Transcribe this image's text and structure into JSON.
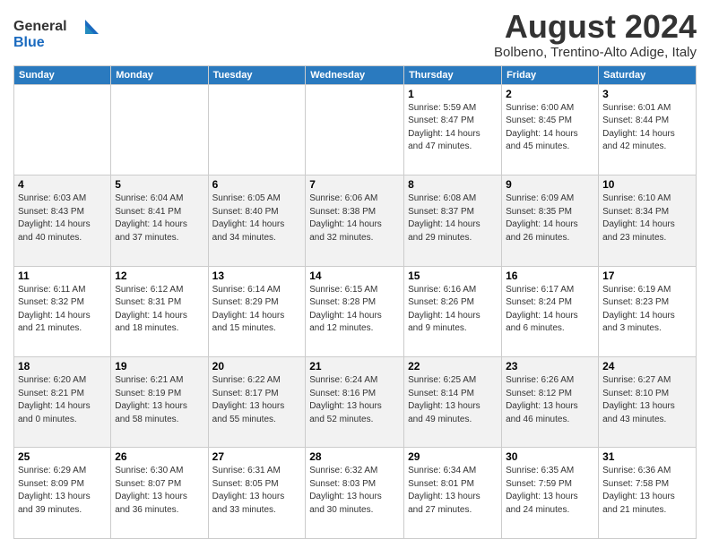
{
  "header": {
    "logo_line1": "General",
    "logo_line2": "Blue",
    "title": "August 2024",
    "subtitle": "Bolbeno, Trentino-Alto Adige, Italy"
  },
  "calendar": {
    "headers": [
      "Sunday",
      "Monday",
      "Tuesday",
      "Wednesday",
      "Thursday",
      "Friday",
      "Saturday"
    ],
    "weeks": [
      [
        {
          "day": "",
          "info": ""
        },
        {
          "day": "",
          "info": ""
        },
        {
          "day": "",
          "info": ""
        },
        {
          "day": "",
          "info": ""
        },
        {
          "day": "1",
          "info": "Sunrise: 5:59 AM\nSunset: 8:47 PM\nDaylight: 14 hours\nand 47 minutes."
        },
        {
          "day": "2",
          "info": "Sunrise: 6:00 AM\nSunset: 8:45 PM\nDaylight: 14 hours\nand 45 minutes."
        },
        {
          "day": "3",
          "info": "Sunrise: 6:01 AM\nSunset: 8:44 PM\nDaylight: 14 hours\nand 42 minutes."
        }
      ],
      [
        {
          "day": "4",
          "info": "Sunrise: 6:03 AM\nSunset: 8:43 PM\nDaylight: 14 hours\nand 40 minutes."
        },
        {
          "day": "5",
          "info": "Sunrise: 6:04 AM\nSunset: 8:41 PM\nDaylight: 14 hours\nand 37 minutes."
        },
        {
          "day": "6",
          "info": "Sunrise: 6:05 AM\nSunset: 8:40 PM\nDaylight: 14 hours\nand 34 minutes."
        },
        {
          "day": "7",
          "info": "Sunrise: 6:06 AM\nSunset: 8:38 PM\nDaylight: 14 hours\nand 32 minutes."
        },
        {
          "day": "8",
          "info": "Sunrise: 6:08 AM\nSunset: 8:37 PM\nDaylight: 14 hours\nand 29 minutes."
        },
        {
          "day": "9",
          "info": "Sunrise: 6:09 AM\nSunset: 8:35 PM\nDaylight: 14 hours\nand 26 minutes."
        },
        {
          "day": "10",
          "info": "Sunrise: 6:10 AM\nSunset: 8:34 PM\nDaylight: 14 hours\nand 23 minutes."
        }
      ],
      [
        {
          "day": "11",
          "info": "Sunrise: 6:11 AM\nSunset: 8:32 PM\nDaylight: 14 hours\nand 21 minutes."
        },
        {
          "day": "12",
          "info": "Sunrise: 6:12 AM\nSunset: 8:31 PM\nDaylight: 14 hours\nand 18 minutes."
        },
        {
          "day": "13",
          "info": "Sunrise: 6:14 AM\nSunset: 8:29 PM\nDaylight: 14 hours\nand 15 minutes."
        },
        {
          "day": "14",
          "info": "Sunrise: 6:15 AM\nSunset: 8:28 PM\nDaylight: 14 hours\nand 12 minutes."
        },
        {
          "day": "15",
          "info": "Sunrise: 6:16 AM\nSunset: 8:26 PM\nDaylight: 14 hours\nand 9 minutes."
        },
        {
          "day": "16",
          "info": "Sunrise: 6:17 AM\nSunset: 8:24 PM\nDaylight: 14 hours\nand 6 minutes."
        },
        {
          "day": "17",
          "info": "Sunrise: 6:19 AM\nSunset: 8:23 PM\nDaylight: 14 hours\nand 3 minutes."
        }
      ],
      [
        {
          "day": "18",
          "info": "Sunrise: 6:20 AM\nSunset: 8:21 PM\nDaylight: 14 hours\nand 0 minutes."
        },
        {
          "day": "19",
          "info": "Sunrise: 6:21 AM\nSunset: 8:19 PM\nDaylight: 13 hours\nand 58 minutes."
        },
        {
          "day": "20",
          "info": "Sunrise: 6:22 AM\nSunset: 8:17 PM\nDaylight: 13 hours\nand 55 minutes."
        },
        {
          "day": "21",
          "info": "Sunrise: 6:24 AM\nSunset: 8:16 PM\nDaylight: 13 hours\nand 52 minutes."
        },
        {
          "day": "22",
          "info": "Sunrise: 6:25 AM\nSunset: 8:14 PM\nDaylight: 13 hours\nand 49 minutes."
        },
        {
          "day": "23",
          "info": "Sunrise: 6:26 AM\nSunset: 8:12 PM\nDaylight: 13 hours\nand 46 minutes."
        },
        {
          "day": "24",
          "info": "Sunrise: 6:27 AM\nSunset: 8:10 PM\nDaylight: 13 hours\nand 43 minutes."
        }
      ],
      [
        {
          "day": "25",
          "info": "Sunrise: 6:29 AM\nSunset: 8:09 PM\nDaylight: 13 hours\nand 39 minutes."
        },
        {
          "day": "26",
          "info": "Sunrise: 6:30 AM\nSunset: 8:07 PM\nDaylight: 13 hours\nand 36 minutes."
        },
        {
          "day": "27",
          "info": "Sunrise: 6:31 AM\nSunset: 8:05 PM\nDaylight: 13 hours\nand 33 minutes."
        },
        {
          "day": "28",
          "info": "Sunrise: 6:32 AM\nSunset: 8:03 PM\nDaylight: 13 hours\nand 30 minutes."
        },
        {
          "day": "29",
          "info": "Sunrise: 6:34 AM\nSunset: 8:01 PM\nDaylight: 13 hours\nand 27 minutes."
        },
        {
          "day": "30",
          "info": "Sunrise: 6:35 AM\nSunset: 7:59 PM\nDaylight: 13 hours\nand 24 minutes."
        },
        {
          "day": "31",
          "info": "Sunrise: 6:36 AM\nSunset: 7:58 PM\nDaylight: 13 hours\nand 21 minutes."
        }
      ]
    ]
  }
}
